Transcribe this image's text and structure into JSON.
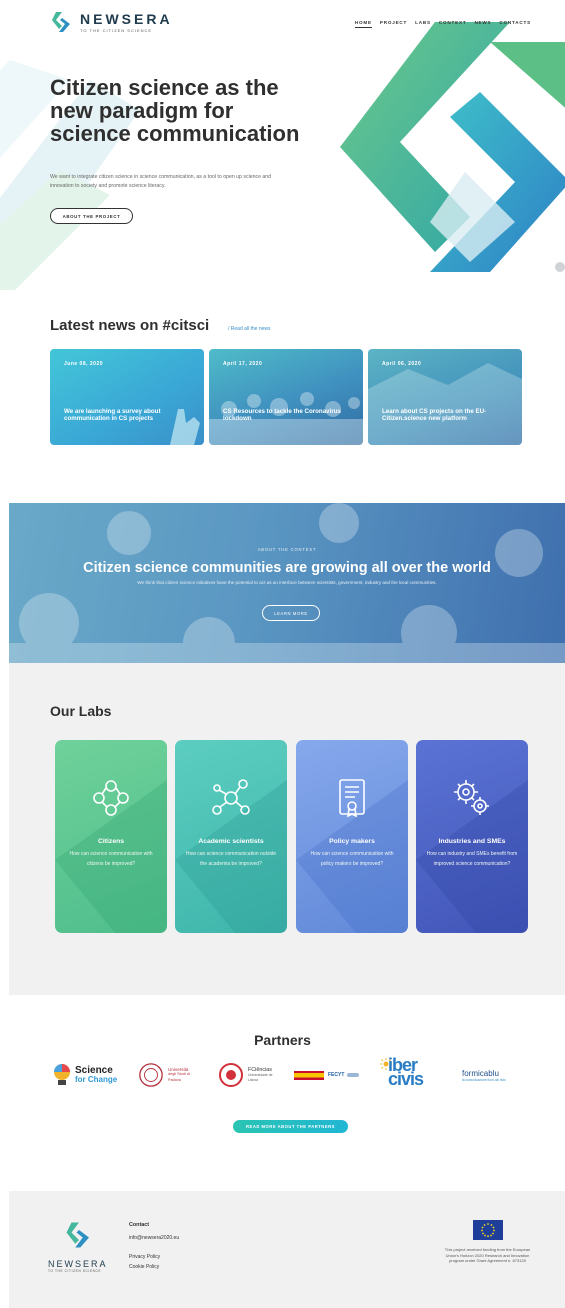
{
  "brand": {
    "name": "NEWSERA",
    "tagline": "TO THE CITIZEN SCIENCE"
  },
  "nav": {
    "items": [
      "HOME",
      "PROJECT",
      "LABS",
      "CONTEXT",
      "NEWS",
      "CONTACTS"
    ],
    "active": "HOME"
  },
  "hero": {
    "title": "Citizen science as the new paradigm for science communication",
    "description": "We want to integrate citizen science in science communication, as a tool to open up science and innovation to society and promote science literacy.",
    "cta": "ABOUT THE PROJECT"
  },
  "news": {
    "title": "Latest news on #citsci",
    "link": "/ Read all the news",
    "cards": [
      {
        "date": "June 08, 2020",
        "headline": "We are launching a survey about communication in CS projects"
      },
      {
        "date": "April 17, 2020",
        "headline": "CS Resources to tackle the Coronavirus lockdown"
      },
      {
        "date": "April 06, 2020",
        "headline": "Learn about CS projects on the EU-Citizen.science new platform"
      }
    ]
  },
  "context": {
    "kicker": "ABOUT THE CONTEXT",
    "title": "Citizen science communities are growing all over the world",
    "description": "We think that citizen science initiatives have the potential to act as an interface between scientists, government, industry and the local communities.",
    "cta": "LEARN MORE"
  },
  "labs": {
    "title": "Our Labs",
    "items": [
      {
        "name": "Citizens",
        "desc": "How can science communication with citizens be improved?",
        "color": "#5fc48f"
      },
      {
        "name": "Academic scientists",
        "desc": "How can science communication outside the academia be improved?",
        "color": "#4fc2b6"
      },
      {
        "name": "Policy makers",
        "desc": "How can science communication with policy makers be improved?",
        "color": "#6f95e0"
      },
      {
        "name": "Industries and SMEs",
        "desc": "How can industry and SMEs benefit from improved science communication?",
        "color": "#4a5fc2"
      }
    ]
  },
  "partners": {
    "title": "Partners",
    "logos": [
      {
        "line1": "Science",
        "line2": "for Change"
      },
      {
        "line1": "Università",
        "line2": "degli Studi di Padova"
      },
      {
        "line1": "FCiências",
        "line2": "Universidade de Lisboa"
      },
      {
        "line1": "FECYT",
        "line2": ""
      },
      {
        "line1": "iber",
        "line2": "civis"
      },
      {
        "line1": "formicablu",
        "line2": "la comunicazione fuori dal nido"
      }
    ],
    "cta": "READ MORE ABOUT THE PARTNERS"
  },
  "footer": {
    "contact_heading": "Contact",
    "email": "info@newsera2020.eu",
    "links": [
      "Privacy Policy",
      "Cookie Policy"
    ],
    "funding": "This project received funding from the European Union's Horizon 2020 Research and Innovation program under Grant Agreement n. 873125"
  },
  "colors": {
    "green": "#5fc48f",
    "teal": "#32b7c6",
    "blue": "#3a8fc8",
    "dark_text": "#2f2f2f"
  }
}
